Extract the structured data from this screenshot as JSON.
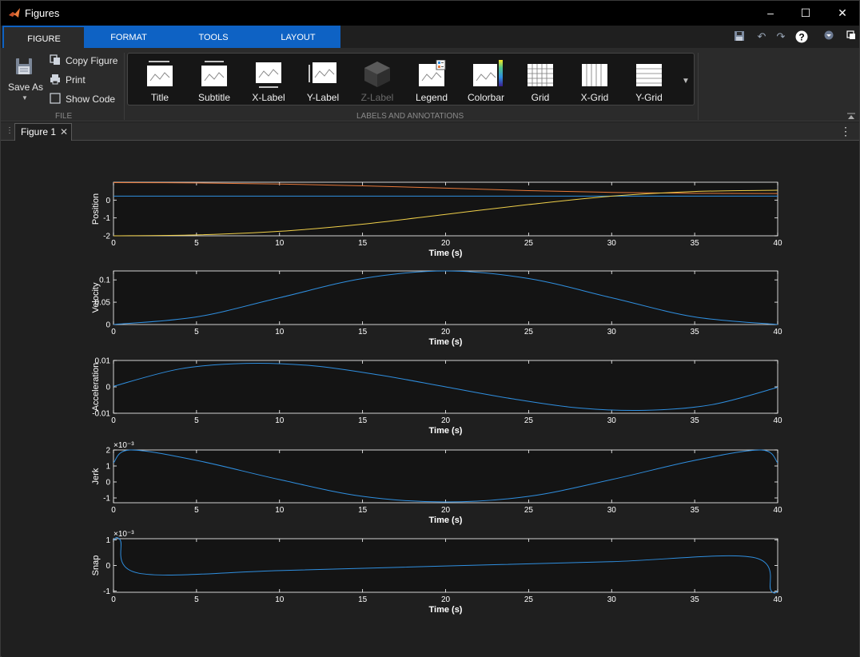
{
  "window": {
    "title": "Figures"
  },
  "ribbon_tabs": [
    {
      "label": "FIGURE",
      "active": true
    },
    {
      "label": "FORMAT",
      "active": false
    },
    {
      "label": "TOOLS",
      "active": false
    },
    {
      "label": "LAYOUT",
      "active": false
    }
  ],
  "file_section": {
    "save_as": "Save As",
    "copy_figure": "Copy Figure",
    "print": "Print",
    "show_code": "Show Code",
    "label": "FILE"
  },
  "labels_section": {
    "label": "LABELS AND ANNOTATIONS",
    "items": [
      {
        "label": "Title",
        "enabled": true
      },
      {
        "label": "Subtitle",
        "enabled": true
      },
      {
        "label": "X-Label",
        "enabled": true
      },
      {
        "label": "Y-Label",
        "enabled": true
      },
      {
        "label": "Z-Label",
        "enabled": false
      },
      {
        "label": "Legend",
        "enabled": true
      },
      {
        "label": "Colorbar",
        "enabled": true
      },
      {
        "label": "Grid",
        "enabled": true
      },
      {
        "label": "X-Grid",
        "enabled": true
      },
      {
        "label": "Y-Grid",
        "enabled": true
      }
    ]
  },
  "document_tab": {
    "label": "Figure 1"
  },
  "colors": {
    "accent": "#0e62c4",
    "axes_bg": "#141414",
    "line_blue": "#2f8fe0",
    "line_orange": "#e8793a",
    "line_yellow": "#f0d04a"
  },
  "chart_data": [
    {
      "type": "line",
      "xlabel": "Time (s)",
      "ylabel": "Position",
      "xlim": [
        0,
        40
      ],
      "ylim": [
        -2,
        1
      ],
      "xticks": [
        0,
        5,
        10,
        15,
        20,
        25,
        30,
        35,
        40
      ],
      "yticks": [
        -2,
        -1,
        0
      ],
      "series": [
        {
          "color": "#2f8fe0",
          "x": [
            0,
            40
          ],
          "y": [
            0.22,
            0.22
          ]
        },
        {
          "color": "#e8793a",
          "x": [
            0,
            5,
            10,
            15,
            20,
            25,
            30,
            35,
            40
          ],
          "y": [
            0.98,
            0.96,
            0.9,
            0.8,
            0.67,
            0.53,
            0.43,
            0.38,
            0.37
          ]
        },
        {
          "color": "#f0d04a",
          "x": [
            0,
            5,
            10,
            15,
            20,
            25,
            30,
            35,
            40
          ],
          "y": [
            -2.0,
            -1.95,
            -1.75,
            -1.35,
            -0.8,
            -0.25,
            0.22,
            0.48,
            0.55
          ]
        }
      ]
    },
    {
      "type": "line",
      "xlabel": "Time (s)",
      "ylabel": "Velocity",
      "xlim": [
        0,
        40
      ],
      "ylim": [
        0,
        0.12
      ],
      "xticks": [
        0,
        5,
        10,
        15,
        20,
        25,
        30,
        35,
        40
      ],
      "yticks": [
        0,
        0.05,
        0.1
      ],
      "series": [
        {
          "color": "#2f8fe0",
          "x": [
            0,
            5,
            10,
            15,
            20,
            25,
            30,
            35,
            40
          ],
          "y": [
            0,
            0.017,
            0.06,
            0.103,
            0.12,
            0.103,
            0.06,
            0.017,
            0
          ]
        }
      ]
    },
    {
      "type": "line",
      "xlabel": "Time (s)",
      "ylabel": "Acceleration",
      "xlim": [
        0,
        40
      ],
      "ylim": [
        -0.01,
        0.01
      ],
      "xticks": [
        0,
        5,
        10,
        15,
        20,
        25,
        30,
        35,
        40
      ],
      "yticks": [
        -0.01,
        0,
        0.01
      ],
      "series": [
        {
          "color": "#2f8fe0",
          "x": [
            0,
            4,
            8,
            12,
            16,
            20,
            24,
            28,
            32,
            36,
            40
          ],
          "y": [
            0.0002,
            0.0068,
            0.0089,
            0.008,
            0.0045,
            0,
            -0.0045,
            -0.008,
            -0.0089,
            -0.0068,
            -0.0002
          ]
        }
      ]
    },
    {
      "type": "line",
      "xlabel": "Time (s)",
      "ylabel": "Jerk",
      "exponent": "×10⁻³",
      "xlim": [
        0,
        40
      ],
      "ylim": [
        -1.3,
        2
      ],
      "xticks": [
        0,
        5,
        10,
        15,
        20,
        25,
        30,
        35,
        40
      ],
      "yticks": [
        -1,
        0,
        1,
        2
      ],
      "series": [
        {
          "color": "#2f8fe0",
          "x": [
            0,
            1,
            5,
            10,
            15,
            20,
            25,
            30,
            35,
            39,
            40
          ],
          "y": [
            1.2,
            2.0,
            1.35,
            0.15,
            -0.9,
            -1.25,
            -0.9,
            0.15,
            1.35,
            2.0,
            1.2
          ]
        }
      ]
    },
    {
      "type": "line",
      "xlabel": "Time (s)",
      "ylabel": "Snap",
      "exponent": "×10⁻³",
      "xlim": [
        0,
        40
      ],
      "ylim": [
        -1.05,
        1.05
      ],
      "xticks": [
        0,
        5,
        10,
        15,
        20,
        25,
        30,
        35,
        40
      ],
      "yticks": [
        -1,
        0,
        1
      ],
      "series": [
        {
          "color": "#2f8fe0",
          "x": [
            0,
            0.4,
            1.5,
            10,
            20,
            30,
            38.5,
            39.6,
            40
          ],
          "y": [
            1.0,
            1.0,
            -0.3,
            -0.2,
            -0.02,
            0.15,
            0.32,
            -0.98,
            -1.0
          ]
        }
      ]
    }
  ]
}
